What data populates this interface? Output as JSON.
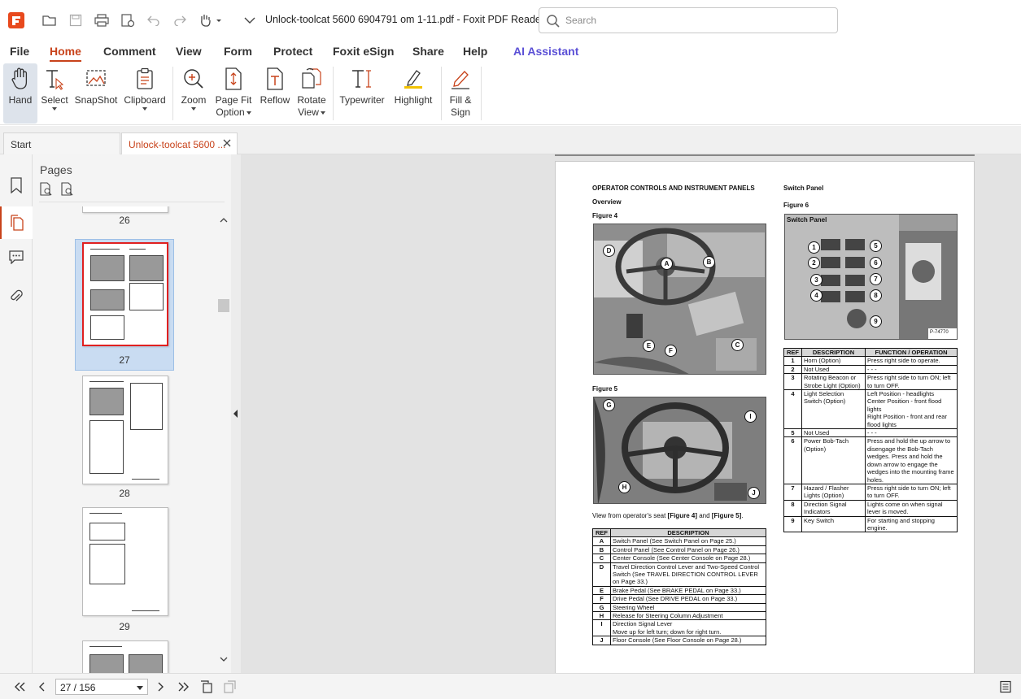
{
  "titlebar": {
    "document_title": "Unlock-toolcat 5600 6904791 om 1-11.pdf - Foxit PDF Reader",
    "search_placeholder": "Search",
    "quick_access": [
      "open-icon",
      "save-icon",
      "print-icon",
      "print-setup-icon",
      "undo-icon",
      "redo-icon",
      "hand-dropdown-icon",
      "customize-dropdown-icon"
    ]
  },
  "menu": {
    "tabs": [
      "File",
      "Home",
      "Comment",
      "View",
      "Form",
      "Protect",
      "Foxit eSign",
      "Share",
      "Help",
      "AI Assistant"
    ],
    "active": "Home"
  },
  "ribbon": {
    "hand": "Hand",
    "select": "Select",
    "snapshot": "SnapShot",
    "clipboard": "Clipboard",
    "zoom": "Zoom",
    "page_fit_1": "Page Fit",
    "page_fit_2": "Option",
    "reflow": "Reflow",
    "rotate_1": "Rotate",
    "rotate_2": "View",
    "typewriter": "Typewriter",
    "highlight": "Highlight",
    "fill_sign_1": "Fill &",
    "fill_sign_2": "Sign"
  },
  "doc_tabs": {
    "start": "Start",
    "active": "Unlock-toolcat 5600 ..."
  },
  "pages_panel": {
    "title": "Pages",
    "page_numbers": [
      "26",
      "27",
      "28",
      "29"
    ],
    "selected_page": "27"
  },
  "status": {
    "page_value": "27 / 156"
  },
  "pdf": {
    "heading": "OPERATOR CONTROLS AND INSTRUMENT PANELS",
    "overview": "Overview",
    "figure4": "Figure 4",
    "figure5": "Figure 5",
    "switch_panel_heading": "Switch Panel",
    "figure6": "Figure 6",
    "photo_caption_switch": "Switch Panel",
    "photo_code": "P-74770",
    "fig4_callouts": [
      "D",
      "A",
      "B",
      "E",
      "F",
      "C"
    ],
    "fig5_callouts": [
      "G",
      "I",
      "H",
      "J"
    ],
    "fig6_callouts": [
      "1",
      "5",
      "2",
      "6",
      "3",
      "7",
      "4",
      "8",
      "9"
    ],
    "view_prefix": "View from operator's seat ",
    "view_fig4": "[Figure 4]",
    "view_and": " and ",
    "view_fig5": "[Figure 5]",
    "view_end": ".",
    "table1": {
      "headers": [
        "REF",
        "DESCRIPTION"
      ],
      "rows": [
        [
          "A",
          "Switch Panel (See Switch Panel on Page 25.)"
        ],
        [
          "B",
          "Control Panel (See Control Panel on Page 26.)"
        ],
        [
          "C",
          "Center Console (See Center Console on Page 28.)"
        ],
        [
          "D",
          "Travel Direction Control Lever and Two-Speed Control Switch (See TRAVEL DIRECTION CONTROL LEVER on Page 33.)"
        ],
        [
          "E",
          "Brake Pedal (See BRAKE PEDAL on Page 33.)"
        ],
        [
          "F",
          "Drive Pedal (See DRIVE PEDAL on Page 33.)"
        ],
        [
          "G",
          "Steering Wheel"
        ],
        [
          "H",
          "Release for Steering Column Adjustment"
        ],
        [
          "I",
          "Direction Signal Lever\nMove up for left turn; down for right turn."
        ],
        [
          "J",
          "Floor Console (See Floor Console on Page 28.)"
        ]
      ]
    },
    "table2": {
      "headers": [
        "REF",
        "DESCRIPTION",
        "FUNCTION / OPERATION"
      ],
      "rows": [
        [
          "1",
          "Horn (Option)",
          "Press right side to operate."
        ],
        [
          "2",
          "Not Used",
          "- - -"
        ],
        [
          "3",
          "Rotating Beacon or Strobe Light (Option)",
          " Press right side to turn ON; left to turn OFF."
        ],
        [
          "4",
          "Light Selection Switch (Option)",
          "Left Position - headlights\nCenter Position - front flood lights\nRight Position - front and rear flood lights"
        ],
        [
          "5",
          "Not Used",
          "- - -"
        ],
        [
          "6",
          "Power Bob-Tach (Option)",
          "Press and hold the up arrow to disengage the Bob-Tach wedges. Press and hold the down arrow to engage the wedges into the mounting frame holes."
        ],
        [
          "7",
          "Hazard / Flasher Lights (Option)",
          "Press right side to turn ON; left to turn OFF."
        ],
        [
          "8",
          "Direction Signal Indicators",
          "Lights come on when signal lever is moved."
        ],
        [
          "9",
          "Key Switch",
          "For starting and stopping engine."
        ]
      ]
    }
  },
  "colors": {
    "accent": "#c8431b",
    "ai_accent": "#5b50d6",
    "logo": "#e8491d",
    "selection_bg": "#c9dcf2",
    "current_page_border": "#e02020"
  }
}
